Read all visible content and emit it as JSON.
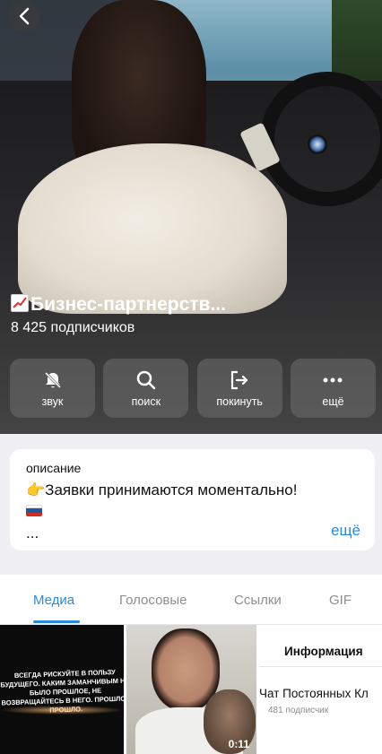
{
  "header": {
    "title": "📈Бизнес-партнерств...",
    "title_text": "Бизнес-партнерств...",
    "subscribers": "8 425 подписчиков"
  },
  "actions": [
    {
      "label": "звук",
      "icon": "bell-slash-icon"
    },
    {
      "label": "поиск",
      "icon": "search-icon"
    },
    {
      "label": "покинуть",
      "icon": "leave-icon"
    },
    {
      "label": "ещё",
      "icon": "more-icon"
    }
  ],
  "description": {
    "caption": "описание",
    "line1": "👉Заявки принимаются моментально!",
    "line1_text": "Заявки принимаются моментально!",
    "line2": "🇷🇺",
    "line3": "...",
    "more": "ещё"
  },
  "tabs": [
    {
      "label": "Медиа",
      "active": true
    },
    {
      "label": "Голосовые",
      "active": false
    },
    {
      "label": "Ссылки",
      "active": false
    },
    {
      "label": "GIF",
      "active": false
    }
  ],
  "media": [
    {
      "type": "image",
      "text": "ВСЕГДА РИСКУЙТЕ В ПОЛЬЗУ БУДУЩЕГО. КАКИМ ЗАМАНЧИВЫМ НИ БЫЛО ПРОШЛОЕ, НЕ ВОЗВРАЩАЙТЕСЬ В НЕГО. ПРОШЛОЕ ПРОШЛО."
    },
    {
      "type": "video",
      "duration": "0:11"
    },
    {
      "type": "link",
      "header": "Информация",
      "title": "Чат Постоянных Кл",
      "subtitle": "481 подписчик"
    }
  ],
  "colors": {
    "accent": "#2a8bd8"
  }
}
